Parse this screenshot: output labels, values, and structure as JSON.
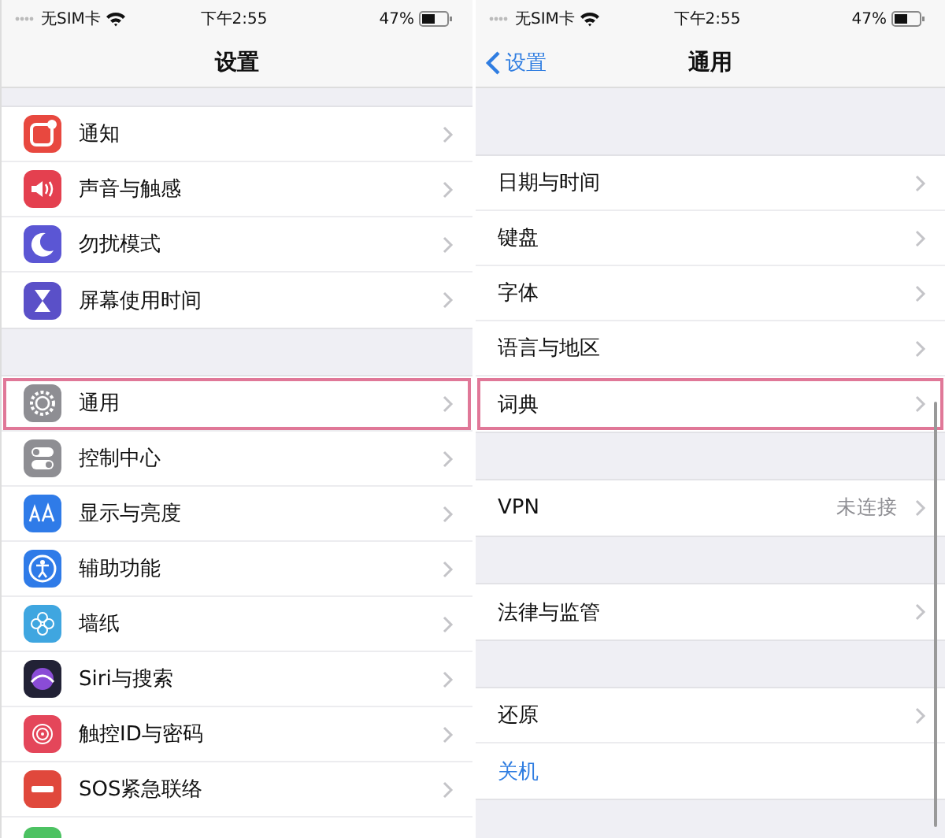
{
  "screens": [
    {
      "status_bar": {
        "carrier": "无SIM卡",
        "time": "下午2:55",
        "battery": "47%"
      },
      "nav": {
        "title": "设置"
      },
      "groups": [
        [
          {
            "label": "通知",
            "color": "#e8483f",
            "highlighted": false
          },
          {
            "label": "声音与触感",
            "color": "#e4404f",
            "highlighted": false
          },
          {
            "label": "勿扰模式",
            "color": "#5b56d4",
            "highlighted": false
          },
          {
            "label": "屏幕使用时间",
            "color": "#5a50c8",
            "highlighted": false
          }
        ],
        [
          {
            "label": "通用",
            "color": "#8e8e93",
            "highlighted": true
          },
          {
            "label": "控制中心",
            "color": "#8e8e93",
            "highlighted": false
          },
          {
            "label": "显示与亮度",
            "color": "#2f7be8",
            "highlighted": false
          },
          {
            "label": "辅助功能",
            "color": "#2f7be8",
            "highlighted": false
          },
          {
            "label": "墙纸",
            "color": "#3fa6e0",
            "highlighted": false
          },
          {
            "label": "Siri与搜索",
            "color": "#222236",
            "highlighted": false
          },
          {
            "label": "触控ID与密码",
            "color": "#e4465a",
            "highlighted": false
          },
          {
            "label": "SOS紧急联络",
            "color": "#e0483c",
            "highlighted": false
          },
          {
            "color": "#4cc262",
            "highlighted": false
          }
        ]
      ]
    },
    {
      "status_bar": {
        "carrier": "无SIM卡",
        "time": "下午2:55",
        "battery": "47%"
      },
      "nav": {
        "title": "通用",
        "back": "设置"
      },
      "groups": [
        [
          {
            "label": "日期与时间",
            "highlighted": false
          },
          {
            "label": "键盘",
            "highlighted": false
          },
          {
            "label": "字体",
            "highlighted": false
          },
          {
            "label": "语言与地区",
            "highlighted": false
          },
          {
            "label": "词典",
            "highlighted": true
          }
        ],
        [
          {
            "label": "VPN",
            "value": "未连接",
            "highlighted": false
          }
        ],
        [
          {
            "label": "法律与监管",
            "highlighted": false
          }
        ],
        [
          {
            "label": "还原",
            "highlighted": false
          },
          {
            "label": "关机",
            "kind": "action",
            "highlighted": false
          }
        ]
      ]
    }
  ]
}
